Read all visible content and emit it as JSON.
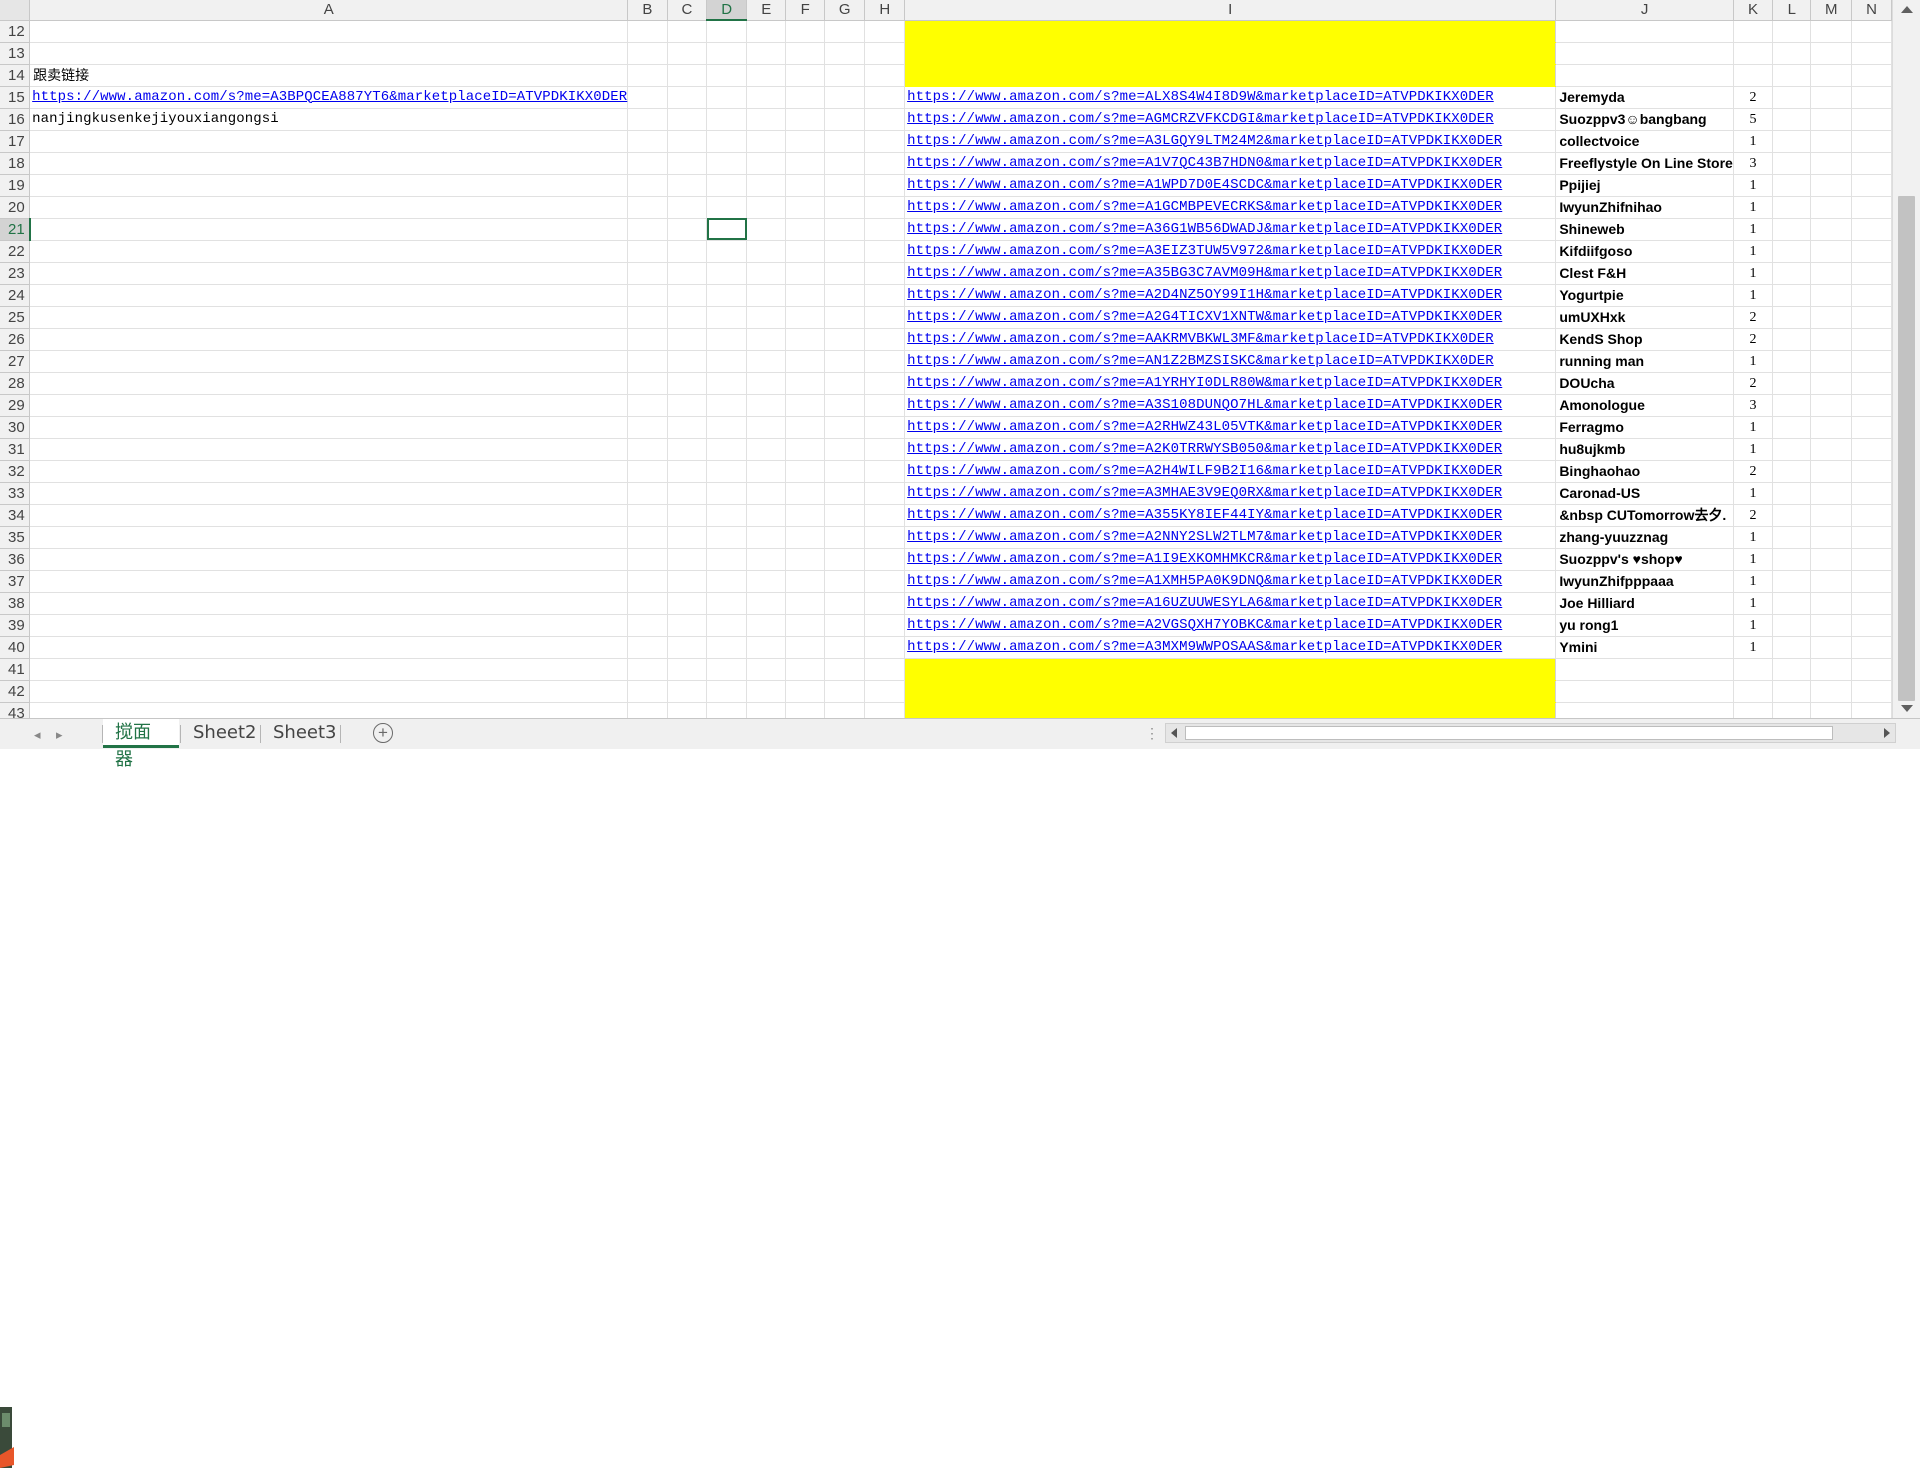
{
  "columns": [
    "A",
    "B",
    "C",
    "D",
    "E",
    "F",
    "G",
    "H",
    "I",
    "J",
    "K",
    "L",
    "M",
    "N"
  ],
  "selected_column": "D",
  "selected_row": 21,
  "left_block": {
    "header": "跟卖链接",
    "link": "https://www.amazon.com/s?me=A3BPQCEA887YT6&marketplaceID=ATVPDKIKX0DER",
    "company": "nanjingkusenkejiyouxiangongsi"
  },
  "rows": [
    {
      "row": "12"
    },
    {
      "row": "13"
    },
    {
      "row": "14"
    },
    {
      "row": "15",
      "url": "https://www.amazon.com/s?me=ALX8S4W4I8D9W&marketplaceID=ATVPDKIKX0DER",
      "seller": "Jeremyda",
      "count": "2"
    },
    {
      "row": "16",
      "url": "https://www.amazon.com/s?me=AGMCRZVFKCDGI&marketplaceID=ATVPDKIKX0DER",
      "seller": "Suozppv3☺bangbang",
      "count": "5"
    },
    {
      "row": "17",
      "url": "https://www.amazon.com/s?me=A3LGQY9LTM24M2&marketplaceID=ATVPDKIKX0DER",
      "seller": "collectvoice",
      "count": "1"
    },
    {
      "row": "18",
      "url": "https://www.amazon.com/s?me=A1V7QC43B7HDN0&marketplaceID=ATVPDKIKX0DER",
      "seller": "Freeflystyle On Line Store",
      "count": "3"
    },
    {
      "row": "19",
      "url": "https://www.amazon.com/s?me=A1WPD7D0E4SCDC&marketplaceID=ATVPDKIKX0DER",
      "seller": "Ppijiej",
      "count": "1"
    },
    {
      "row": "20",
      "url": "https://www.amazon.com/s?me=A1GCMBPEVECRKS&marketplaceID=ATVPDKIKX0DER",
      "seller": "IwyunZhifnihao",
      "count": "1"
    },
    {
      "row": "21",
      "url": "https://www.amazon.com/s?me=A36G1WB56DWADJ&marketplaceID=ATVPDKIKX0DER",
      "seller": "Shineweb",
      "count": "1"
    },
    {
      "row": "22",
      "url": "https://www.amazon.com/s?me=A3EIZ3TUW5V972&marketplaceID=ATVPDKIKX0DER",
      "seller": "Kifdiifgoso",
      "count": "1"
    },
    {
      "row": "23",
      "url": "https://www.amazon.com/s?me=A35BG3C7AVM09H&marketplaceID=ATVPDKIKX0DER",
      "seller": "Clest F&H",
      "count": "1"
    },
    {
      "row": "24",
      "url": "https://www.amazon.com/s?me=A2D4NZ5OY99I1H&marketplaceID=ATVPDKIKX0DER",
      "seller": "Yogurtpie",
      "count": "1"
    },
    {
      "row": "25",
      "url": "https://www.amazon.com/s?me=A2G4TICXV1XNTW&marketplaceID=ATVPDKIKX0DER",
      "seller": "umUXHxk",
      "count": "2"
    },
    {
      "row": "26",
      "url": "https://www.amazon.com/s?me=AAKRMVBKWL3MF&marketplaceID=ATVPDKIKX0DER",
      "seller": "KendS Shop",
      "count": "2"
    },
    {
      "row": "27",
      "url": "https://www.amazon.com/s?me=AN1Z2BMZSISKC&marketplaceID=ATVPDKIKX0DER",
      "seller": "running man",
      "count": "1"
    },
    {
      "row": "28",
      "url": "https://www.amazon.com/s?me=A1YRHYI0DLR80W&marketplaceID=ATVPDKIKX0DER",
      "seller": "DOUcha",
      "count": "2"
    },
    {
      "row": "29",
      "url": "https://www.amazon.com/s?me=A3S108DUNQO7HL&marketplaceID=ATVPDKIKX0DER",
      "seller": "Amonologue",
      "count": "3"
    },
    {
      "row": "30",
      "url": "https://www.amazon.com/s?me=A2RHWZ43L05VTK&marketplaceID=ATVPDKIKX0DER",
      "seller": "Ferragmo",
      "count": "1"
    },
    {
      "row": "31",
      "url": "https://www.amazon.com/s?me=A2K0TRRWYSB050&marketplaceID=ATVPDKIKX0DER",
      "seller": "hu8ujkmb",
      "count": "1"
    },
    {
      "row": "32",
      "url": "https://www.amazon.com/s?me=A2H4WILF9B2I16&marketplaceID=ATVPDKIKX0DER",
      "seller": "Binghaohao",
      "count": "2"
    },
    {
      "row": "33",
      "url": "https://www.amazon.com/s?me=A3MHAE3V9EQ0RX&marketplaceID=ATVPDKIKX0DER",
      "seller": "Caronad-US",
      "count": "1"
    },
    {
      "row": "34",
      "url": "https://www.amazon.com/s?me=A355KY8IEF44IY&marketplaceID=ATVPDKIKX0DER",
      "seller": "&nbsp CUTomorrow去夕.",
      "count": "2"
    },
    {
      "row": "35",
      "url": "https://www.amazon.com/s?me=A2NNY2SLW2TLM7&marketplaceID=ATVPDKIKX0DER",
      "seller": "zhang-yuuzznag",
      "count": "1"
    },
    {
      "row": "36",
      "url": "https://www.amazon.com/s?me=A1I9EXKOMHMKCR&marketplaceID=ATVPDKIKX0DER",
      "seller": "Suozppv's ♥shop♥",
      "count": "1"
    },
    {
      "row": "37",
      "url": "https://www.amazon.com/s?me=A1XMH5PA0K9DNQ&marketplaceID=ATVPDKIKX0DER",
      "seller": "IwyunZhifpppaaa",
      "count": "1"
    },
    {
      "row": "38",
      "url": "https://www.amazon.com/s?me=A16UZUUWESYLA6&marketplaceID=ATVPDKIKX0DER",
      "seller": "Joe Hilliard",
      "count": "1"
    },
    {
      "row": "39",
      "url": "https://www.amazon.com/s?me=A2VGSQXH7YOBKC&marketplaceID=ATVPDKIKX0DER",
      "seller": "yu rong1",
      "count": "1"
    },
    {
      "row": "40",
      "url": "https://www.amazon.com/s?me=A3MXM9WWPOSAAS&marketplaceID=ATVPDKIKX0DER",
      "seller": "Ymini",
      "count": "1"
    },
    {
      "row": "41"
    },
    {
      "row": "42"
    },
    {
      "row": "43"
    }
  ],
  "sheet_tabs": [
    "搅面器",
    "Sheet2",
    "Sheet3"
  ],
  "active_tab": "搅面器",
  "add_sheet_label": "+",
  "nav_prev_label": "◂",
  "nav_next_label": "▸",
  "hscroll_dots": "⋮",
  "colors": {
    "yellow_fill": "#ffff00",
    "link_blue": "#0000ee",
    "seller_orange": "#c55a11",
    "header_red": "#e00000",
    "excel_green": "#217346"
  },
  "icons": [
    "scroll-up-icon",
    "scroll-down-icon",
    "add-sheet-icon",
    "scroll-left-icon",
    "scroll-right-icon",
    "tab-prev-icon",
    "tab-next-icon"
  ]
}
